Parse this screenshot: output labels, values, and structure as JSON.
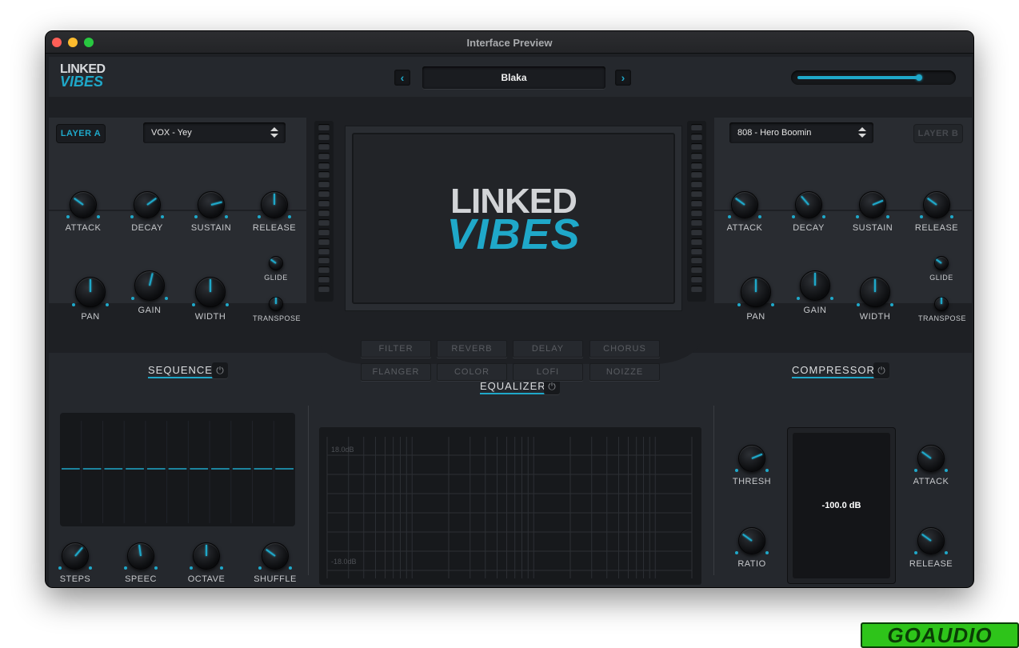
{
  "window": {
    "title": "Interface Preview",
    "traffic_lights": [
      "#ff5f57",
      "#febc2e",
      "#28c840"
    ]
  },
  "header": {
    "logo_line1": "LINKED",
    "logo_line2": "VIBES",
    "prev_icon": "chevron-left-icon",
    "next_icon": "chevron-right-icon",
    "prev_glyph": "‹",
    "next_glyph": "›",
    "preset_name": "Blaka",
    "volume_level": 0.8
  },
  "layer_a": {
    "tab_label": "LAYER A",
    "active": true,
    "sound": "VOX - Yey",
    "envelope": [
      {
        "label": "ATTACK",
        "value": 0.3
      },
      {
        "label": "DECAY",
        "value": 0.7
      },
      {
        "label": "SUSTAIN",
        "value": 0.78
      },
      {
        "label": "RELEASE",
        "value": 0.5
      }
    ],
    "mix": [
      {
        "label": "PAN",
        "value": 0.5
      },
      {
        "label": "GAIN",
        "value": 0.55
      },
      {
        "label": "WIDTH",
        "value": 0.5
      }
    ],
    "small": [
      {
        "label": "GLIDE",
        "value": 0.3
      },
      {
        "label": "TRANSPOSE",
        "value": 0.5
      }
    ]
  },
  "layer_b": {
    "tab_label": "LAYER B",
    "active": false,
    "sound": "808 -  Hero Boomin",
    "envelope": [
      {
        "label": "ATTACK",
        "value": 0.3
      },
      {
        "label": "DECAY",
        "value": 0.35
      },
      {
        "label": "SUSTAIN",
        "value": 0.75
      },
      {
        "label": "RELEASE",
        "value": 0.3
      }
    ],
    "mix": [
      {
        "label": "PAN",
        "value": 0.5
      },
      {
        "label": "GAIN",
        "value": 0.5
      },
      {
        "label": "WIDTH",
        "value": 0.5
      }
    ],
    "small": [
      {
        "label": "GLIDE",
        "value": 0.3
      },
      {
        "label": "TRANSPOSE",
        "value": 0.5
      }
    ]
  },
  "display": {
    "logo_line1": "LINKED",
    "logo_line2": "VIBES"
  },
  "effects": [
    "FILTER",
    "REVERB",
    "DELAY",
    "CHORUS",
    "FLANGER",
    "COLOR",
    "LOFI",
    "NOIZZE"
  ],
  "sequence": {
    "title": "SEQUENCE",
    "power_icon": "power-icon",
    "steps": 11,
    "knobs": [
      {
        "label": "STEPS",
        "value": 0.65
      },
      {
        "label": "SPEEC",
        "value": 0.47
      },
      {
        "label": "OCTAVE",
        "value": 0.5
      },
      {
        "label": "SHUFFLE",
        "value": 0.3
      }
    ]
  },
  "equalizer": {
    "title": "EQUALIZER",
    "power_icon": "power-icon",
    "top_label": "18.0dB",
    "bottom_label": "-18.0dB"
  },
  "compressor": {
    "title": "COMPRESSOR",
    "power_icon": "power-icon",
    "readout": "-100.0 dB",
    "knobs": [
      {
        "label": "THRESH",
        "value": 0.75
      },
      {
        "label": "ATTACK",
        "value": 0.3
      },
      {
        "label": "RATIO",
        "value": 0.3
      },
      {
        "label": "RELEASE",
        "value": 0.3
      }
    ]
  },
  "colors": {
    "accent": "#1fa8c9",
    "panel": "#292c31",
    "background": "#1e2024"
  },
  "watermark": "GOAUDIO"
}
